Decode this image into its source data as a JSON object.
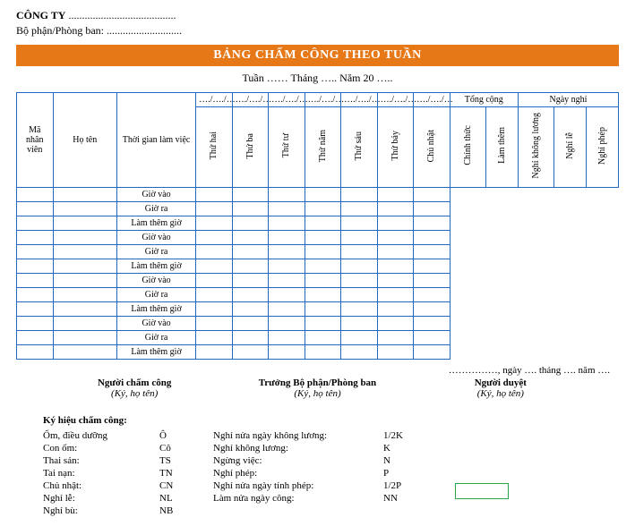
{
  "header": {
    "company_label": "CÔNG TY",
    "company_dots": "........................................",
    "dept_label": "Bộ phận/Phòng ban:",
    "dept_dots": "............................"
  },
  "title": "BẢNG CHẤM CÔNG THEO TUẦN",
  "subtitle": "Tuần …… Tháng ….. Năm 20 …..",
  "cols": {
    "emp_id": "Mã nhân viên",
    "name": "Họ tên",
    "worktime": "Thời gian làm việc",
    "date_ph": "…./…./…",
    "mon": "Thứ hai",
    "tue": "Thứ ba",
    "wed": "Thứ tư",
    "thu": "Thứ năm",
    "fri": "Thứ sáu",
    "sat": "Thứ bảy",
    "sun": "Chủ nhật",
    "total": "Tổng cộng",
    "total_official": "Chính thức",
    "total_ot": "Làm thêm",
    "off": "Ngày nghỉ",
    "off_nowage": "Nghỉ không lương",
    "off_holiday": "Nghỉ lễ",
    "off_leave": "Nghỉ phép"
  },
  "time_labels": {
    "in": "Giờ vào",
    "out": "Giờ ra",
    "ot": "Làm thêm giờ"
  },
  "date_line": "……………, ngày …. tháng …. năm ….",
  "signatures": {
    "s1_t": "Người chấm công",
    "s1_s": "(Ký, họ tên)",
    "s2_t": "Trưởng Bộ phận/Phòng ban",
    "s2_s": "(Ký, họ tên)",
    "s3_t": "Người duyệt",
    "s3_s": "(Ký, họ tên)"
  },
  "legend": {
    "title": "Ký hiệu chấm công:",
    "l1": [
      "Ốm, điều dưỡng",
      "Con ốm:",
      "Thai sản:",
      "Tai nạn:",
      "Chủ nhật:",
      "Nghỉ lễ:",
      "Nghỉ bù:"
    ],
    "l2": [
      "Ô",
      "Cô",
      "TS",
      "TN",
      "CN",
      "NL",
      "NB"
    ],
    "l3": [
      "Nghỉ nửa ngày không lương:",
      "Nghỉ không lương:",
      "Ngừng việc:",
      "Nghỉ phép:",
      "Nghỉ nửa ngày tính phép:",
      "Làm nửa ngày công:"
    ],
    "l4": [
      "1/2K",
      "K",
      "N",
      "P",
      "1/2P",
      "NN"
    ]
  }
}
